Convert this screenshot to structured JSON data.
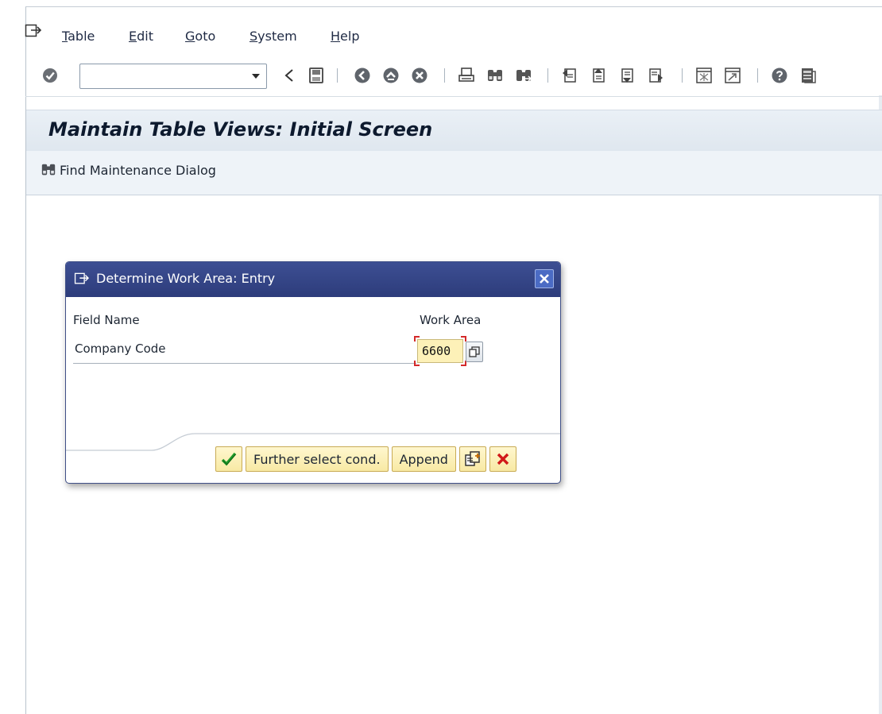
{
  "menu": {
    "items": [
      {
        "label": "Table",
        "accel": "T",
        "rest": "able"
      },
      {
        "label": "Edit",
        "accel": "E",
        "rest": "dit"
      },
      {
        "label": "Goto",
        "accel": "G",
        "rest": "oto"
      },
      {
        "label": "System",
        "accel": "S",
        "rest": "ystem"
      },
      {
        "label": "Help",
        "accel": "H",
        "rest": "elp"
      }
    ]
  },
  "toolbar": {
    "command_value": "",
    "icons": [
      "enter-icon",
      "back-icon",
      "save-icon",
      "back-nav-icon",
      "exit-icon",
      "cancel-icon",
      "print-icon",
      "find-icon",
      "find-next-icon",
      "first-page-icon",
      "previous-page-icon",
      "next-page-icon",
      "last-page-icon",
      "create-session-icon",
      "shortcut-icon",
      "help-icon",
      "layout-icon"
    ]
  },
  "screen": {
    "title": "Maintain Table Views: Initial Screen",
    "app_button": "Find Maintenance Dialog"
  },
  "dialog": {
    "title": "Determine Work Area: Entry",
    "col_field": "Field Name",
    "col_work_area": "Work Area",
    "field_label": "Company Code",
    "work_area_value": "6600",
    "buttons": {
      "further": "Further select cond.",
      "append": "Append"
    }
  },
  "colors": {
    "dialog_header": "#2d3c7b",
    "button_yellow": "#f8e9a4",
    "input_yellow": "#fdf1b8",
    "title_bg": "#dfe7ef"
  }
}
